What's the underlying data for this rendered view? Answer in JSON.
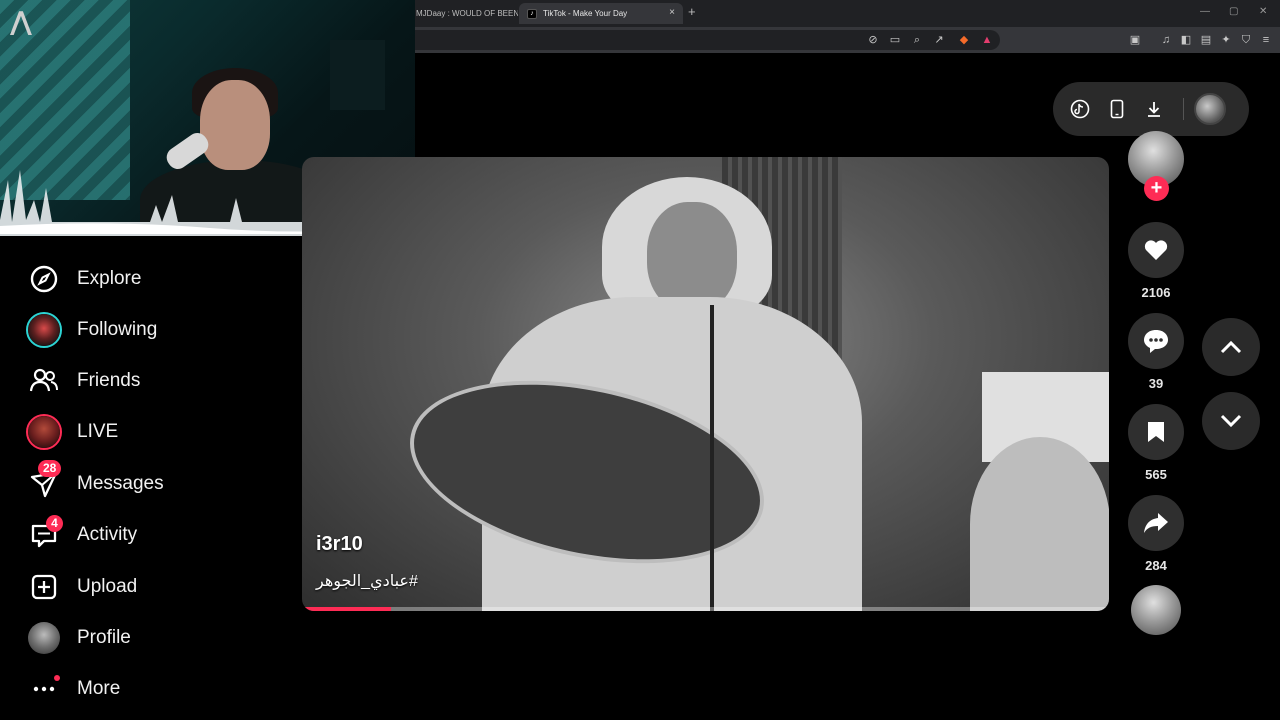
{
  "browser": {
    "tabs": [
      {
        "title": "MJDaay : WOULD OF BEEN",
        "active": false
      },
      {
        "title": "TikTok - Make Your Day",
        "active": true
      }
    ],
    "tab_close": "×",
    "new_tab": "+",
    "window_controls": [
      "—",
      "▢",
      "✕"
    ]
  },
  "sidebar": {
    "items": [
      {
        "label": "Explore",
        "icon": "compass-icon"
      },
      {
        "label": "Following",
        "icon": "following-avatar"
      },
      {
        "label": "Friends",
        "icon": "friends-icon"
      },
      {
        "label": "LIVE",
        "icon": "live-avatar"
      },
      {
        "label": "Messages",
        "icon": "messages-icon",
        "badge": "28"
      },
      {
        "label": "Activity",
        "icon": "activity-icon",
        "badge": "4"
      },
      {
        "label": "Upload",
        "icon": "upload-icon"
      },
      {
        "label": "Profile",
        "icon": "profile-avatar"
      },
      {
        "label": "More",
        "icon": "more-icon",
        "dot": true
      }
    ]
  },
  "video": {
    "author": "i3r10",
    "hashtag": "#عبادي_الجوهر",
    "progress": 0.11
  },
  "actions": {
    "likes": "2106",
    "comments": "39",
    "saves": "565",
    "shares": "284"
  },
  "colors": {
    "accent": "#fe2c55",
    "teal": "#2dd4d4",
    "background": "#000000"
  }
}
